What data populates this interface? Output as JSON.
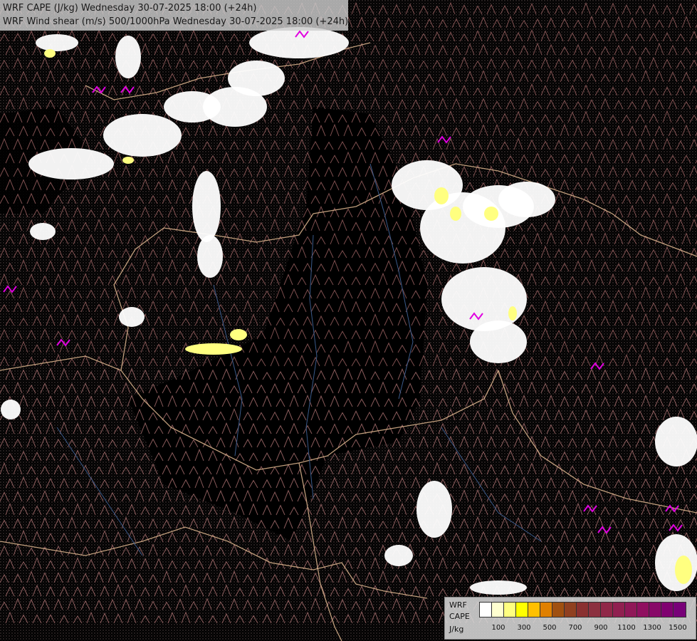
{
  "title": {
    "line1": "WRF CAPE (J/kg) Wednesday 30-07-2025 18:00 (+24h)",
    "line2": "WRF Wind shear (m/s) 500/1000hPa Wednesday 30-07-2025 18:00 (+24h)"
  },
  "legend": {
    "label_line1": "WRF",
    "label_line2": "CAPE",
    "label_line3": "J/kg",
    "colors": [
      "#ffffff",
      "#ffffd0",
      "#ffff80",
      "#ffff00",
      "#ffc000",
      "#e08000",
      "#a05010",
      "#904020",
      "#8a3030",
      "#8c3040",
      "#902848",
      "#902050",
      "#901858",
      "#901060",
      "#880868",
      "#800070",
      "#780078"
    ],
    "ticks": [
      "100",
      "300",
      "500",
      "700",
      "900",
      "1100",
      "1300",
      "1500"
    ]
  },
  "colors": {
    "background": "#000000",
    "barb": "#a86a6a",
    "barb_strong": "#b87a7a",
    "border": "#e0b890",
    "river": "#3a5a8a",
    "cape_low": "#ffffff",
    "cape_mid": "#ffff80",
    "shear_high": "#e000e0"
  }
}
